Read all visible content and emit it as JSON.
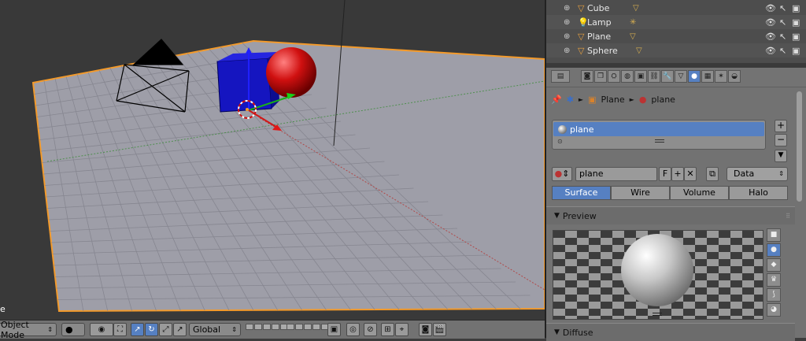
{
  "viewport": {
    "corner_label": "e",
    "mode_label": "Object Mode",
    "orientation_label": "Global"
  },
  "outliner": {
    "rows": [
      {
        "name": "Cube",
        "type": "mesh"
      },
      {
        "name": "Lamp",
        "type": "lamp"
      },
      {
        "name": "Plane",
        "type": "mesh"
      },
      {
        "name": "Sphere",
        "type": "mesh"
      }
    ]
  },
  "properties": {
    "context": {
      "object": "Plane",
      "material": "plane"
    },
    "slot_list": [
      {
        "name": "plane",
        "selected": true
      }
    ],
    "material_name": "plane",
    "fake_user": "F",
    "data_select": "Data",
    "type_tabs": [
      {
        "label": "Surface",
        "active": true
      },
      {
        "label": "Wire",
        "active": false
      },
      {
        "label": "Volume",
        "active": false
      },
      {
        "label": "Halo",
        "active": false
      }
    ],
    "panels": {
      "preview": "Preview",
      "diffuse": "Diffuse"
    }
  },
  "colors": {
    "accent": "#5680c2",
    "selection": "#f39a2b"
  }
}
